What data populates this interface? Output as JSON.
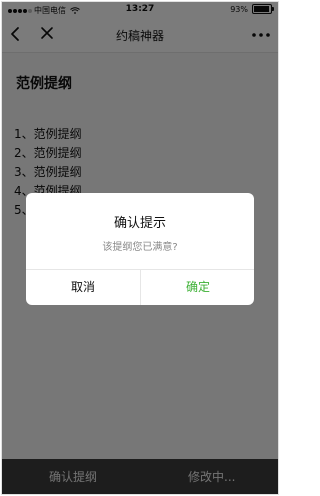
{
  "status_bar": {
    "carrier": "中国电信",
    "time": "13:27",
    "battery_text": "93%",
    "battery_level": 0.93,
    "signal_icon": "signal-dots-icon",
    "wifi_icon": "wifi-icon",
    "battery_icon": "battery-icon"
  },
  "nav": {
    "title": "约稿神器",
    "back_icon": "back-arrow-icon",
    "close_icon": "close-icon",
    "more_icon": "more-dots-icon"
  },
  "content": {
    "heading": "范例提纲",
    "items": [
      "1、范例提纲",
      "2、范例提纲",
      "3、范例提纲",
      "4、范例提纲",
      "5、范例提纲"
    ]
  },
  "bottom_bar": {
    "confirm_label": "确认提纲",
    "editing_label": "修改中..."
  },
  "dialog": {
    "title": "确认提示",
    "message": "该提纲您已满意?",
    "cancel_label": "取消",
    "ok_label": "确定",
    "ok_color": "#3cb034",
    "cancel_color": "#111111"
  },
  "colors": {
    "overlay": "#000000",
    "bottom_bar": "#3a3a3a",
    "page_background": "#efefef"
  }
}
